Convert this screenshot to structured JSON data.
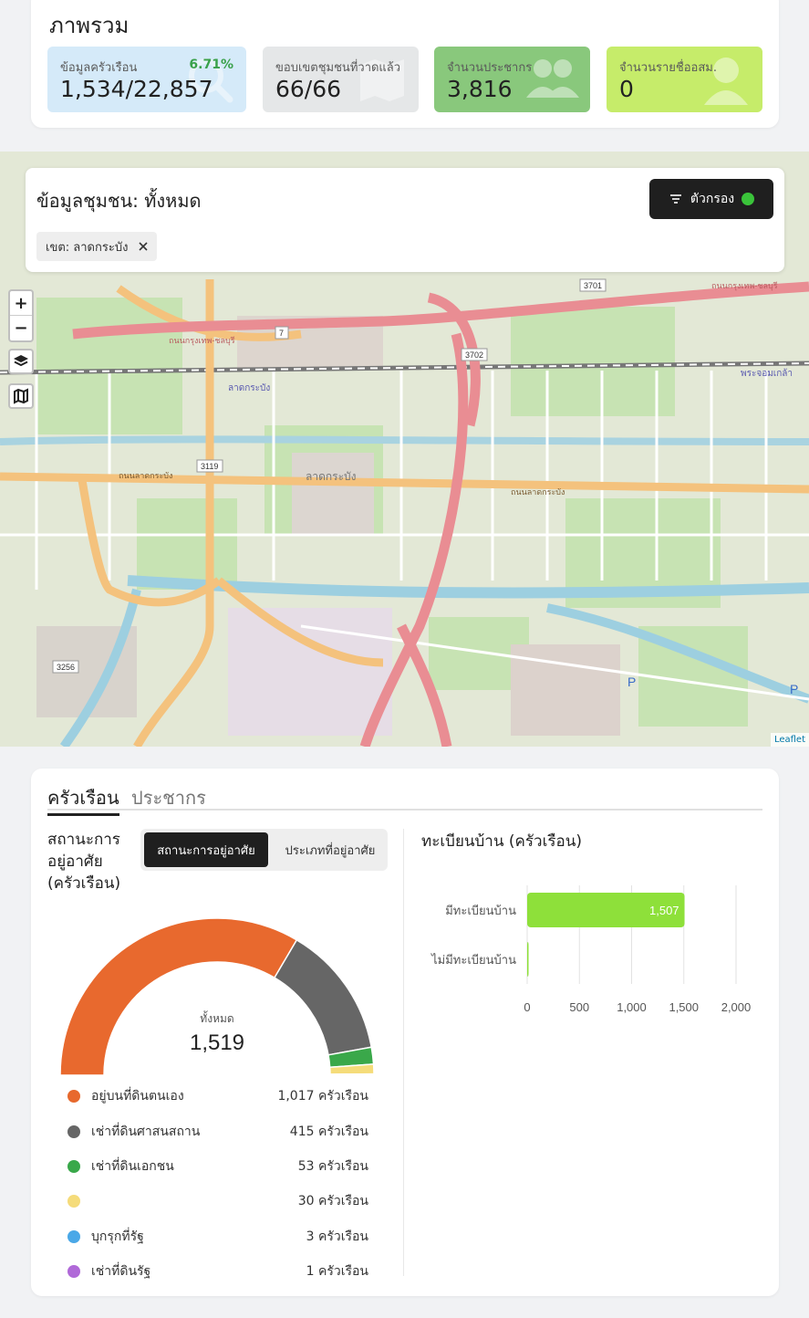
{
  "overview": {
    "title": "ภาพรวม",
    "stats": [
      {
        "label": "ข้อมูลครัวเรือน",
        "value": "1,534/22,857",
        "percent": "6.71%",
        "icon": "search-icon"
      },
      {
        "label": "ขอบเขตชุมชนที่วาดแล้ว",
        "value": "66/66",
        "icon": "map-icon"
      },
      {
        "label": "จำนวนประชากร",
        "value": "3,816",
        "icon": "users-icon"
      },
      {
        "label": "จำนวนรายชื่ออสม.",
        "value": "0",
        "icon": "user-icon"
      }
    ]
  },
  "map": {
    "title": "ข้อมูลชุมชน: ทั้งหมด",
    "filter_label": "ตัวกรอง",
    "chip_label": "เขต: ลาดกระบัง",
    "zoom_in": "+",
    "zoom_out": "−",
    "attribution": "Leaflet",
    "labels": {
      "road_motorway": "ถนนกรุงเทพ-ชลบุรี",
      "road_motorway_right": "ถนนกรุงเทพ-ชลบุรี",
      "road_lat_krabang": "ถนนลาดกระบัง",
      "road_lat_krabang_right": "ถนนลาดกระบัง",
      "district": "ลาดกระบัง",
      "station": "ลาดกระบัง",
      "station_right": "พระจอมเกล้า",
      "ref_3701": "3701",
      "ref_3702": "3702",
      "ref_3119": "3119",
      "ref_3256": "3256",
      "ref_7": "7",
      "parking": "P"
    }
  },
  "households": {
    "tabs": [
      "ครัวเรือน",
      "ประชากร"
    ],
    "section_title": "สถานะการอยู่อาศัย (ครัวเรือน)",
    "segments": [
      "สถานะการอยู่อาศัย",
      "ประเภทที่อยู่อาศัย"
    ],
    "gauge": {
      "total_label": "ทั้งหมด",
      "total": "1,519"
    },
    "legend": [
      {
        "label": "อยู่บนที่ดินตนเอง",
        "value": "1,017 ครัวเรือน",
        "count": 1017,
        "color": "#e8692e"
      },
      {
        "label": "เช่าที่ดินศาสนสถาน",
        "value": "415 ครัวเรือน",
        "count": 415,
        "color": "#666666"
      },
      {
        "label": "เช่าที่ดินเอกชน",
        "value": "53 ครัวเรือน",
        "count": 53,
        "color": "#3aa84a"
      },
      {
        "label": "",
        "value": "30 ครัวเรือน",
        "count": 30,
        "color": "#f5dc7a"
      },
      {
        "label": "บุกรุกที่รัฐ",
        "value": "3 ครัวเรือน",
        "count": 3,
        "color": "#4aa8e8"
      },
      {
        "label": "เช่าที่ดินรัฐ",
        "value": "1 ครัวเรือน",
        "count": 1,
        "color": "#b06ad8"
      }
    ]
  },
  "chart_data": {
    "type": "bar",
    "orientation": "horizontal",
    "title": "ทะเบียนบ้าน (ครัวเรือน)",
    "categories": [
      "มีทะเบียนบ้าน",
      "ไม่มีทะเบียนบ้าน"
    ],
    "values": [
      1507,
      12
    ],
    "value_labels": [
      "1,507",
      ""
    ],
    "xlim": [
      0,
      2000
    ],
    "xticks": [
      0,
      500,
      1000,
      1500,
      2000
    ],
    "xtick_labels": [
      "0",
      "500",
      "1,000",
      "1,500",
      "2,000"
    ],
    "color": "#8ee03a",
    "grid": true
  }
}
